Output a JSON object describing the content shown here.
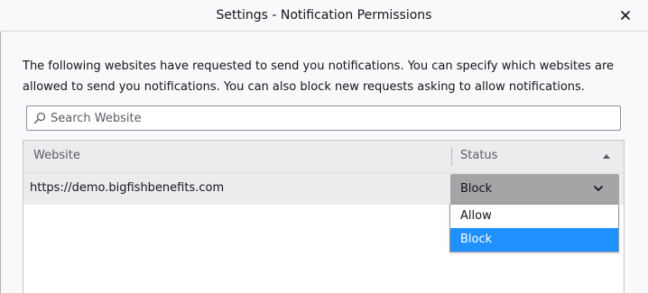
{
  "window": {
    "title": "Settings - Notification Permissions"
  },
  "description": "The following websites have requested to send you notifications. You can specify which websites are allowed to send you notifications. You can also block new requests asking to allow notifications.",
  "search": {
    "placeholder": "Search Website",
    "value": "",
    "icon": "search-icon"
  },
  "table": {
    "columns": [
      "Website",
      "Status"
    ],
    "sort": {
      "column": "Status",
      "direction": "ascending"
    },
    "rows": [
      {
        "website": "https://demo.bigfishbenefits.com",
        "status": "Block"
      }
    ]
  },
  "status_dropdown": {
    "selected": "Block",
    "options": [
      "Allow",
      "Block"
    ],
    "highlighted": "Block"
  },
  "colors": {
    "highlight": "#1e90ff",
    "select_background": "#a5a5a8",
    "header_background": "#ececee"
  }
}
